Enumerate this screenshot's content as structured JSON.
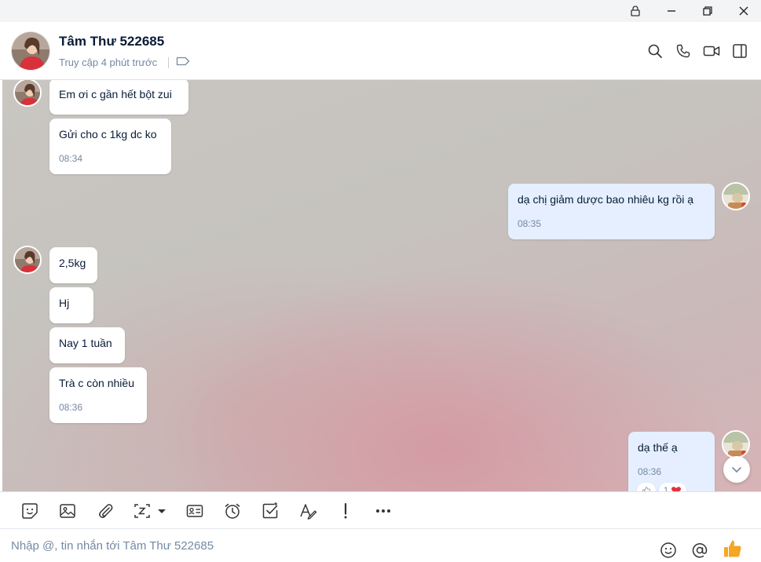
{
  "window": {
    "controls": [
      {
        "name": "lock-icon"
      },
      {
        "name": "minimize-icon"
      },
      {
        "name": "restore-icon"
      },
      {
        "name": "close-icon"
      }
    ]
  },
  "header": {
    "contact_name": "Tâm Thư 522685",
    "status": "Truy cập 4 phút trước",
    "icons": [
      "search-icon",
      "phone-icon",
      "video-icon",
      "sidebar-toggle-icon"
    ]
  },
  "messages": [
    {
      "from": "them",
      "text": "Em ơi c gần hết bột zui",
      "time": ""
    },
    {
      "from": "them",
      "text": "Gửi cho c 1kg dc ko",
      "time": "08:34"
    },
    {
      "from": "me",
      "text": "dạ chị giảm dược bao nhiêu kg rồi ạ",
      "time": "08:35"
    },
    {
      "from": "them",
      "text": "2,5kg",
      "time": ""
    },
    {
      "from": "them",
      "text": "Hj",
      "time": ""
    },
    {
      "from": "them",
      "text": "Nay 1 tuần",
      "time": ""
    },
    {
      "from": "them",
      "text": "Trà c còn nhiều",
      "time": "08:36"
    },
    {
      "from": "me",
      "text": "dạ thế ạ",
      "time": "08:36"
    }
  ],
  "reactions": {
    "count": "1"
  },
  "toolbar": {
    "tools": [
      "sticker-icon",
      "image-icon",
      "attachment-icon",
      "screenshot-icon",
      "contact-card-icon",
      "reminder-icon",
      "todo-icon",
      "text-format-icon",
      "urgent-icon",
      "more-icon"
    ]
  },
  "composer": {
    "placeholder": "Nhập @, tin nhắn tới Tâm Thư 522685",
    "value": ""
  },
  "colors": {
    "accent": "#0068ff",
    "my_bubble": "#e5efff",
    "their_bubble": "#ffffff",
    "like": "#f5a623"
  }
}
